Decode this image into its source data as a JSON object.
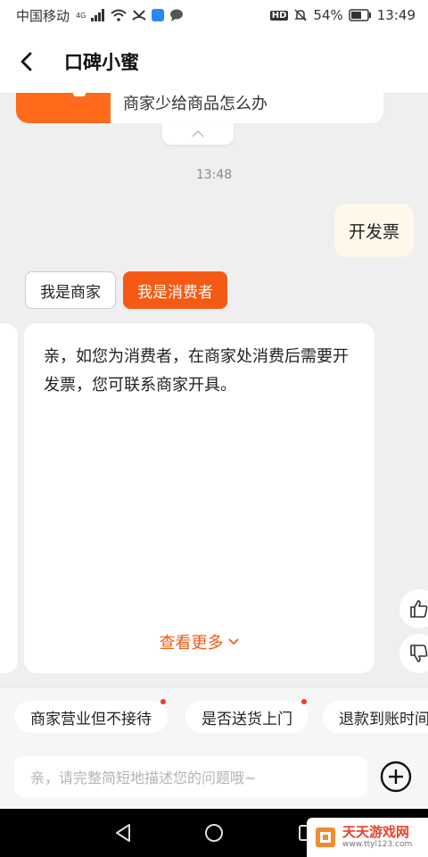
{
  "status_bar": {
    "carrier": "中国移动",
    "network": "4G",
    "battery": "54%",
    "time": "13:49",
    "icons": [
      "signal-icon",
      "wifi-icon",
      "missed-call-icon",
      "app-notification-icon",
      "message-icon",
      "hd-icon",
      "mute-icon",
      "battery-icon"
    ]
  },
  "header": {
    "title": "口碑小蜜",
    "back_icon": "chevron-left-icon"
  },
  "chat": {
    "previous_card_text": "商家少给商品怎么办",
    "timestamp": "13:48",
    "user_message": "开发票",
    "role_options": [
      {
        "label": "我是商家",
        "selected": false
      },
      {
        "label": "我是消费者",
        "selected": true
      }
    ],
    "answer": {
      "text": "亲，如您为消费者，在商家处消费后需要开发票，您可联系商家开具。",
      "more_link": "查看更多"
    }
  },
  "quick_replies": [
    {
      "label": "商家营业但不接待",
      "dot": true
    },
    {
      "label": "是否送货上门",
      "dot": true
    },
    {
      "label": "退款到账时间",
      "dot": false
    }
  ],
  "input": {
    "placeholder": "亲，请完整简短地描述您的问题哦~"
  },
  "watermark": {
    "name": "天天游戏网",
    "url": "www.ttyl123.com"
  },
  "colors": {
    "accent": "#f55a14",
    "user_bubble": "#fdf8ea",
    "background": "#efefef",
    "red_dot": "#f03a2e"
  }
}
